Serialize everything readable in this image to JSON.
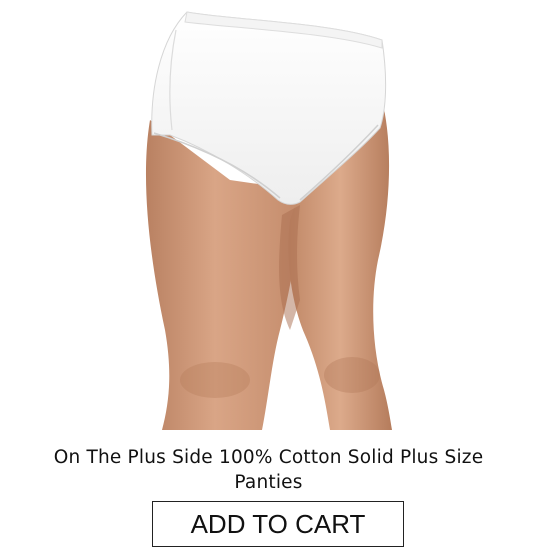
{
  "product": {
    "image_alt": "White cotton briefs worn by model",
    "title": "On The Plus Side 100% Cotton Solid Plus Size Panties"
  },
  "actions": {
    "add_to_cart_label": "ADD TO CART"
  },
  "colors": {
    "background": "#ffffff",
    "text": "#111111",
    "button_border": "#222222"
  }
}
